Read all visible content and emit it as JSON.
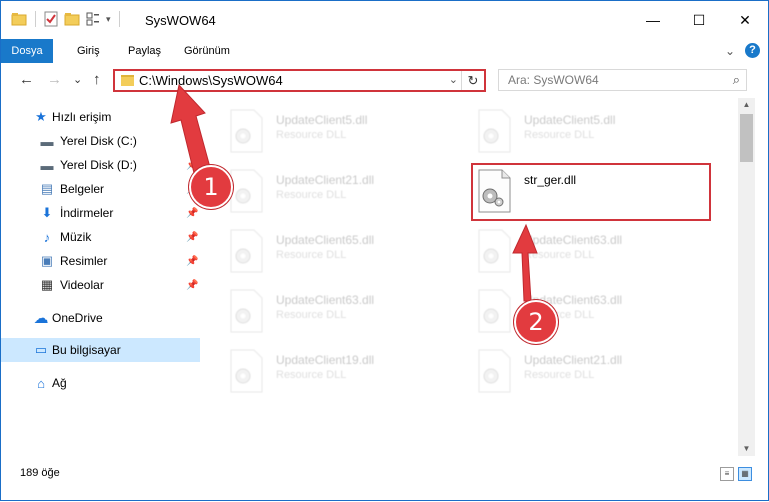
{
  "window": {
    "title": "SysWOW64"
  },
  "window_buttons": {
    "minimize": "—",
    "maximize": "☐",
    "close": "✕"
  },
  "ribbon": {
    "tabs": [
      "Dosya",
      "Giriş",
      "Paylaş",
      "Görünüm"
    ],
    "expand": "⌄",
    "help": "?"
  },
  "nav": {
    "back": "←",
    "forward": "→",
    "recent": "⌄",
    "up": "↑"
  },
  "address": {
    "path": "C:\\Windows\\SysWOW64",
    "dropdown": "⌄",
    "refresh": "↻"
  },
  "search": {
    "placeholder": "Ara: SysWOW64",
    "icon": "⌕"
  },
  "sidebar": {
    "items": [
      {
        "label": "Hızlı erişim",
        "icon": "★"
      },
      {
        "label": "Yerel Disk (C:)",
        "icon": "▬"
      },
      {
        "label": "Yerel Disk (D:)",
        "icon": "▬"
      },
      {
        "label": "Belgeler",
        "icon": "▤"
      },
      {
        "label": "İndirmeler",
        "icon": "⬇"
      },
      {
        "label": "Müzik",
        "icon": "♪"
      },
      {
        "label": "Resimler",
        "icon": "▣"
      },
      {
        "label": "Videolar",
        "icon": "▦"
      },
      {
        "label": "OneDrive",
        "icon": "☁"
      },
      {
        "label": "Bu bilgisayar",
        "icon": "▭"
      },
      {
        "label": "Ağ",
        "icon": "⌂"
      }
    ],
    "pin": "📌"
  },
  "files": [
    {
      "name": "UpdateClient5.dll",
      "desc": "Resource DLL"
    },
    {
      "name": "UpdateClient5.dll",
      "desc": "Resource DLL"
    },
    {
      "name": "UpdateClient21.dll",
      "desc": "Resource DLL"
    },
    {
      "name": "str_ger.dll",
      "desc": ""
    },
    {
      "name": "UpdateClient65.dll",
      "desc": "Resource DLL"
    },
    {
      "name": "UpdateClient63.dll",
      "desc": "Resource DLL"
    },
    {
      "name": "UpdateClient63.dll",
      "desc": "Resource DLL"
    },
    {
      "name": "UpdateClient63.dll",
      "desc": "Resource DLL"
    },
    {
      "name": "UpdateClient19.dll",
      "desc": "Resource DLL"
    },
    {
      "name": "UpdateClient21.dll",
      "desc": "Resource DLL"
    }
  ],
  "status": {
    "count": "189 öğe"
  },
  "annotations": {
    "badge1": "1",
    "badge2": "2",
    "color": "#e23b3f"
  },
  "colors": {
    "accent": "#1979ca",
    "selection": "#cce8ff",
    "highlight": "#d0343b"
  }
}
